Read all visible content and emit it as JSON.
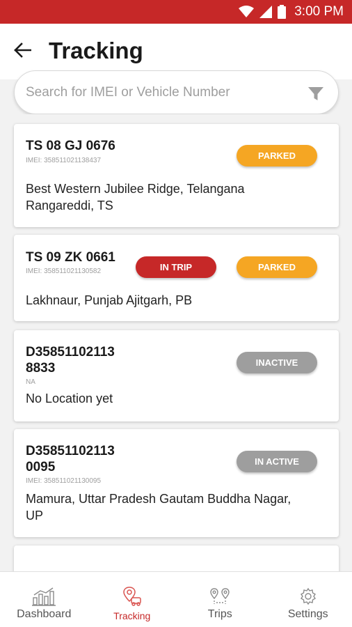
{
  "status_bar": {
    "time": "3:00 PM"
  },
  "header": {
    "title": "Tracking"
  },
  "search": {
    "placeholder": "Search for IMEI or Vehicle Number",
    "value": ""
  },
  "vehicles": [
    {
      "name_line1": "TS 08 GJ 0676",
      "name_line2": "",
      "imei": "IMEI: 358511021138437",
      "location_line1": "Best Western Jubilee Ridge, Telangana",
      "location_line2": "Rangareddi, TS",
      "status_primary": "",
      "status_secondary": "PARKED"
    },
    {
      "name_line1": "TS 09 ZK 0661",
      "name_line2": "",
      "imei": "IMEI: 358511021130582",
      "location_line1": "Lakhnaur, Punjab Ajitgarh, PB",
      "location_line2": "",
      "status_primary": "IN TRIP",
      "status_secondary": "PARKED"
    },
    {
      "name_line1": "D35851102113",
      "name_line2": "8833",
      "imei": "NA",
      "location_line1": "No Location yet",
      "location_line2": "",
      "status_primary": "",
      "status_secondary": "INACTIVE"
    },
    {
      "name_line1": "D35851102113",
      "name_line2": "0095",
      "imei": "IMEI: 358511021130095",
      "location_line1": "Mamura, Uttar Pradesh Gautam Buddha Nagar,",
      "location_line2": "UP",
      "status_primary": "",
      "status_secondary": "IN ACTIVE"
    }
  ],
  "bottom_nav": [
    {
      "label": "Dashboard",
      "icon": "bar-chart-icon",
      "active": false
    },
    {
      "label": "Tracking",
      "icon": "location-pin-icon",
      "active": true
    },
    {
      "label": "Trips",
      "icon": "trip-pins-icon",
      "active": false
    },
    {
      "label": "Settings",
      "icon": "gear-icon",
      "active": false
    }
  ],
  "colors": {
    "primary": "#c62828",
    "parked": "#f5a623",
    "inactive": "#9e9e9e"
  }
}
